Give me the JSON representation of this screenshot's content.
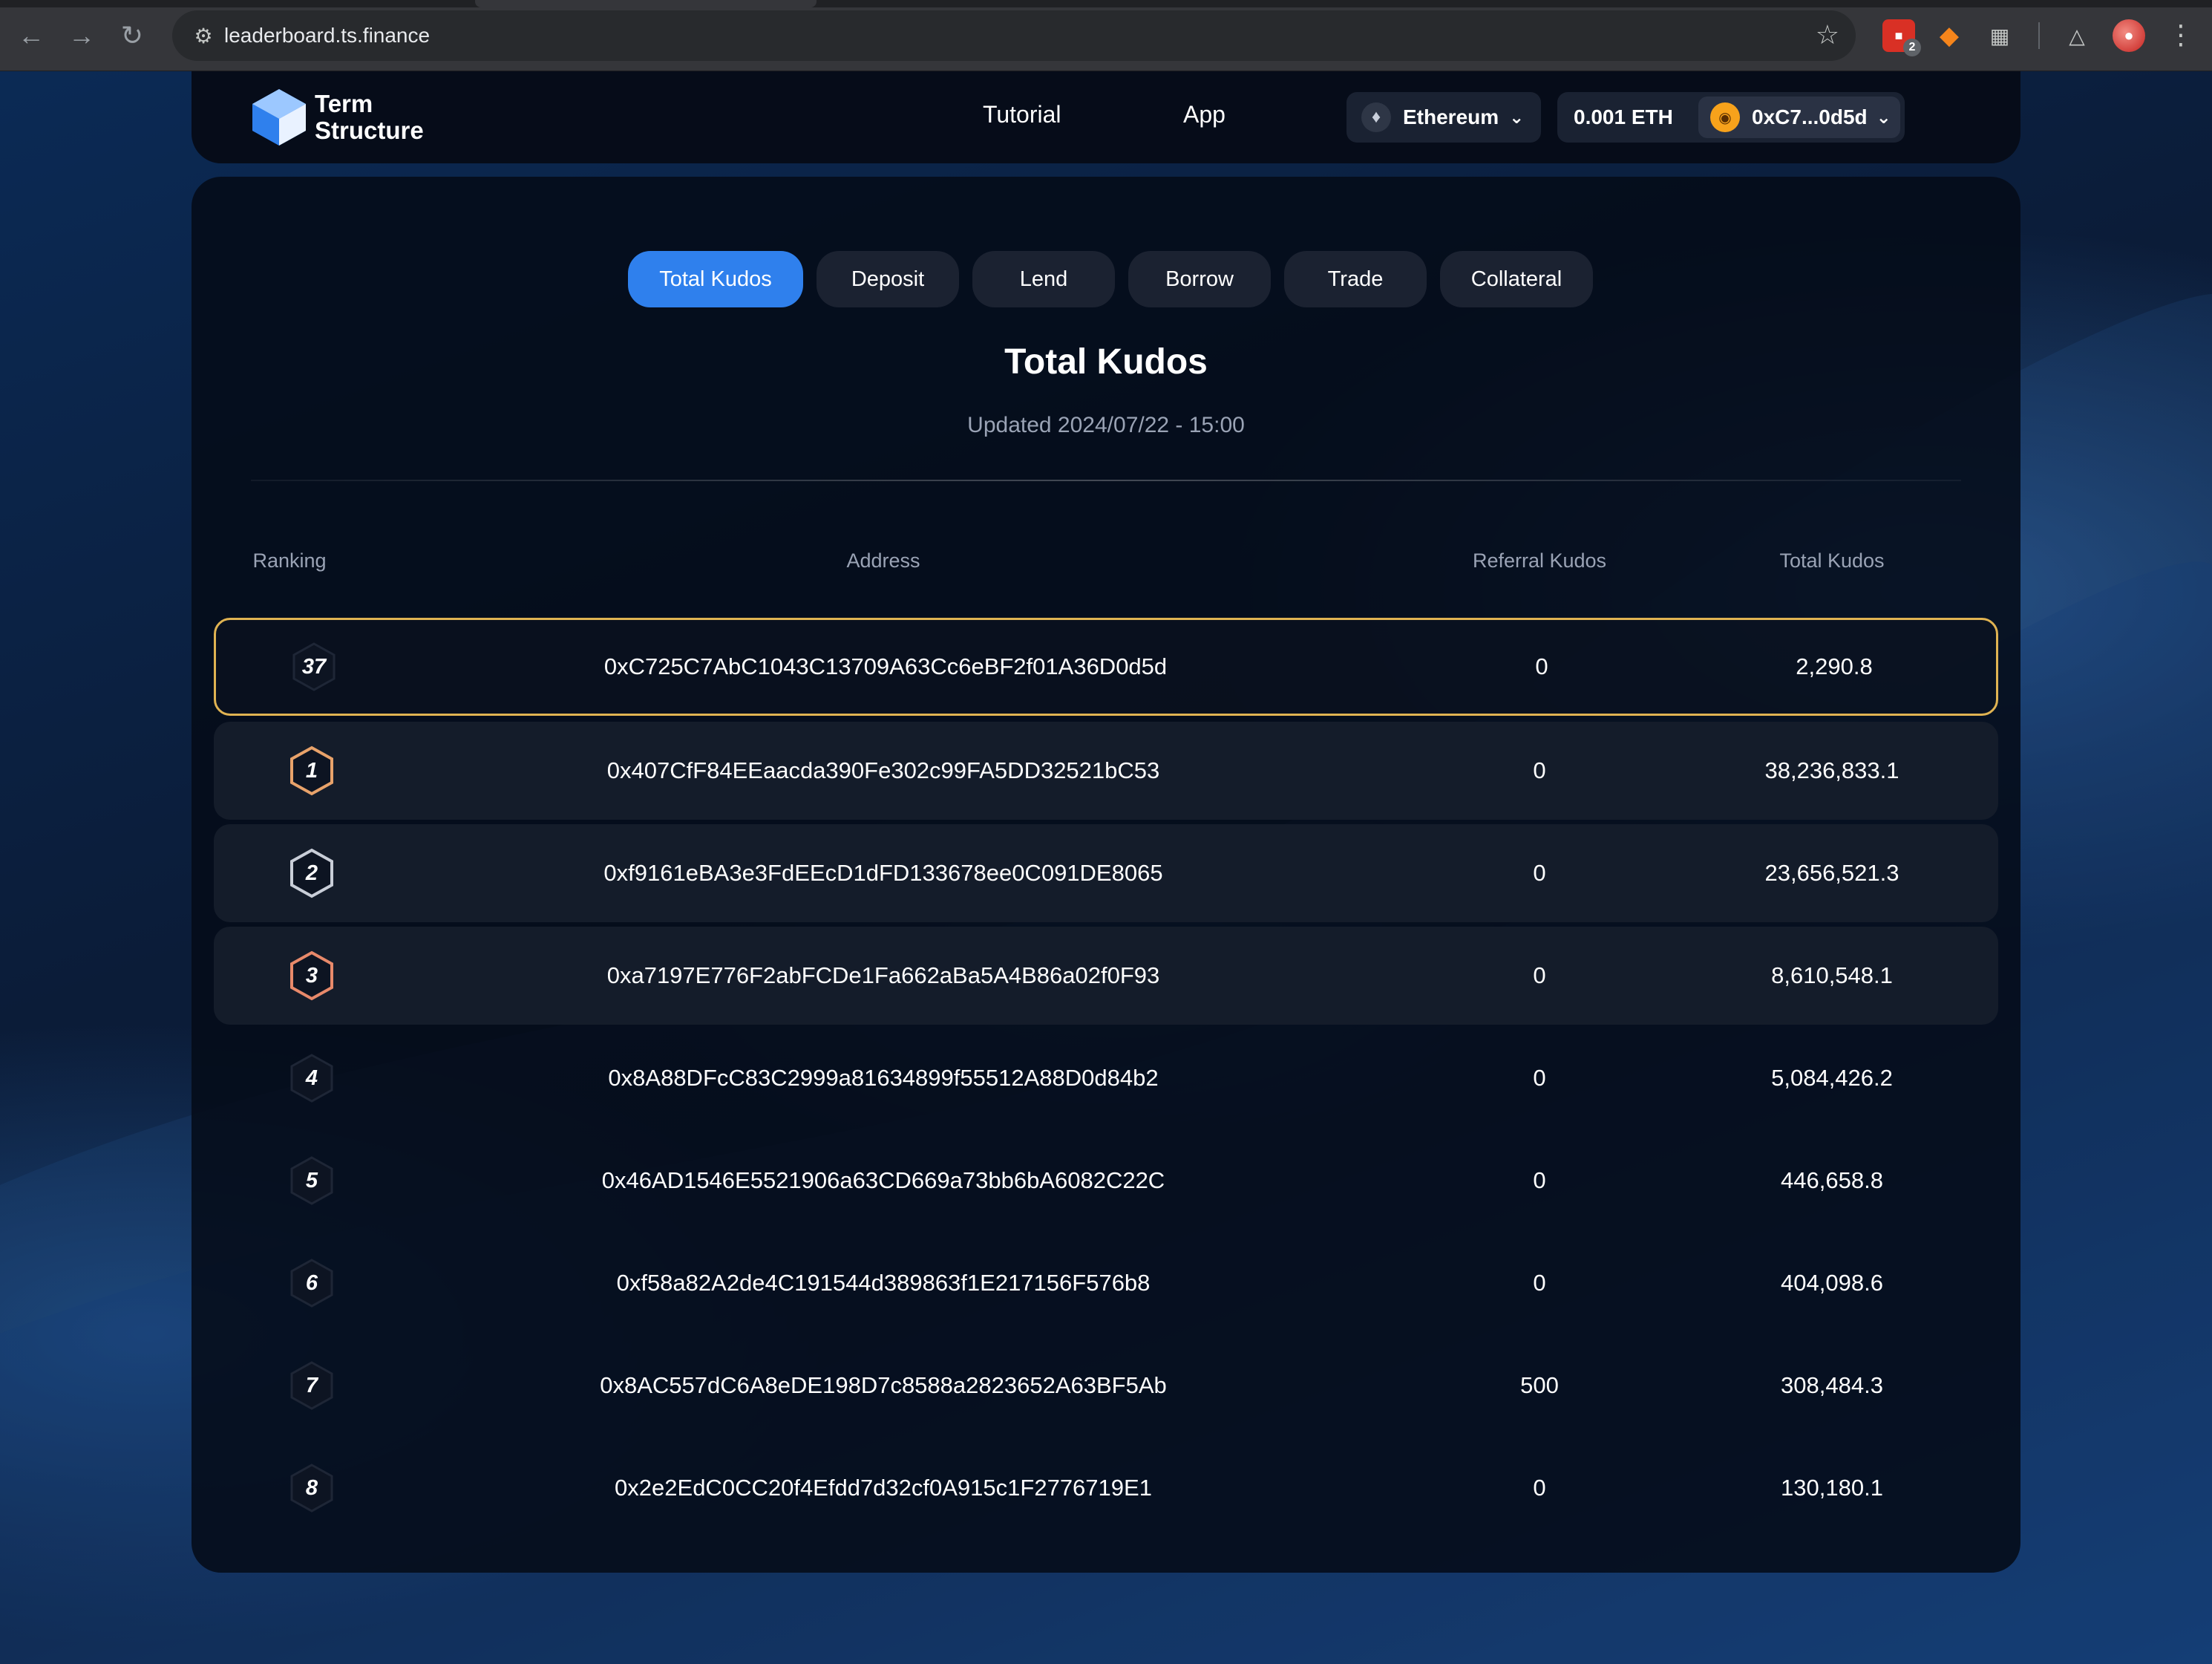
{
  "browser": {
    "url": "leaderboard.ts.finance",
    "ext_badge": "2"
  },
  "brand": {
    "line1": "Term",
    "line2": "Structure",
    "accent": "#2f80ed"
  },
  "nav": {
    "tutorial": "Tutorial",
    "app": "App"
  },
  "network": {
    "label": "Ethereum"
  },
  "wallet": {
    "balance": "0.001 ETH",
    "address": "0xC7...0d5d"
  },
  "tabs": [
    {
      "label": "Total Kudos",
      "active": true
    },
    {
      "label": "Deposit",
      "active": false
    },
    {
      "label": "Lend",
      "active": false
    },
    {
      "label": "Borrow",
      "active": false
    },
    {
      "label": "Trade",
      "active": false
    },
    {
      "label": "Collateral",
      "active": false
    }
  ],
  "board": {
    "title": "Total Kudos",
    "updated": "Updated 2024/07/22 - 15:00",
    "columns": {
      "ranking": "Ranking",
      "address": "Address",
      "referral": "Referral Kudos",
      "total": "Total Kudos"
    },
    "rows": [
      {
        "rank": "37",
        "address": "0xC725C7AbC1043C13709A63Cc6eBF2f01A36D0d5d",
        "referral": "0",
        "total": "2,290.8",
        "style": "me"
      },
      {
        "rank": "1",
        "address": "0x407CfF84EEaacda390Fe302c99FA5DD32521bC53",
        "referral": "0",
        "total": "38,236,833.1",
        "style": "top"
      },
      {
        "rank": "2",
        "address": "0xf9161eBA3e3FdEEcD1dFD133678ee0C091DE8065",
        "referral": "0",
        "total": "23,656,521.3",
        "style": "top"
      },
      {
        "rank": "3",
        "address": "0xa7197E776F2abFCDe1Fa662aBa5A4B86a02f0F93",
        "referral": "0",
        "total": "8,610,548.1",
        "style": "top"
      },
      {
        "rank": "4",
        "address": "0x8A88DFcC83C2999a81634899f55512A88D0d84b2",
        "referral": "0",
        "total": "5,084,426.2",
        "style": "plain"
      },
      {
        "rank": "5",
        "address": "0x46AD1546E5521906a63CD669a73bb6bA6082C22C",
        "referral": "0",
        "total": "446,658.8",
        "style": "plain"
      },
      {
        "rank": "6",
        "address": "0xf58a82A2de4C191544d389863f1E217156F576b8",
        "referral": "0",
        "total": "404,098.6",
        "style": "plain"
      },
      {
        "rank": "7",
        "address": "0x8AC557dC6A8eDE198D7c8588a2823652A63BF5Ab",
        "referral": "500",
        "total": "308,484.3",
        "style": "plain"
      },
      {
        "rank": "8",
        "address": "0x2e2EdC0CC20f4Efdd7d32cf0A915c1F2776719E1",
        "referral": "0",
        "total": "130,180.1",
        "style": "plain"
      }
    ]
  },
  "badge_colors": {
    "me": "#1e2636",
    "gold": "#e8a26a",
    "silver": "#c9ced8",
    "bronze": "#e8896a",
    "plain": "#1e2636"
  }
}
